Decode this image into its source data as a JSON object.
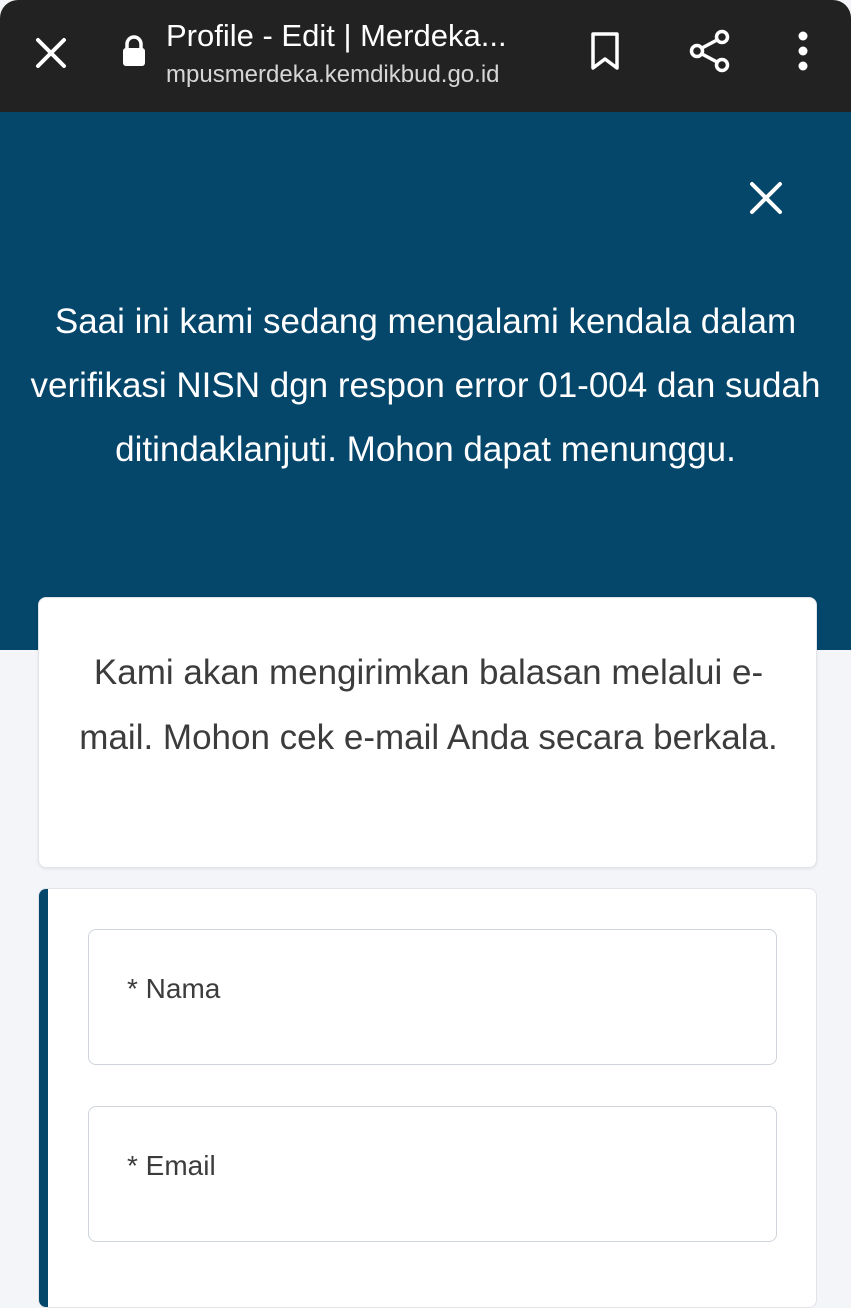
{
  "browser": {
    "page_title": "Profile - Edit | Merdeka...",
    "url": "mpusmerdeka.kemdikbud.go.id",
    "icons": {
      "close": "close-icon",
      "lock": "lock-icon",
      "bookmark": "bookmark-icon",
      "share": "share-icon",
      "more": "more-vert-icon"
    }
  },
  "banner": {
    "message": "Saai ini kami sedang mengalami kendala dalam verifikasi NISN dgn respon error 01-004 dan sudah ditindaklanjuti. Mohon dapat menunggu.",
    "background_color": "#05466b"
  },
  "info_card": {
    "message": "Kami akan mengirimkan balasan melalui e-mail. Mohon cek e-mail Anda secara berkala."
  },
  "form": {
    "fields": [
      {
        "label": "* Nama",
        "value": ""
      },
      {
        "label": "* Email",
        "value": ""
      }
    ]
  }
}
